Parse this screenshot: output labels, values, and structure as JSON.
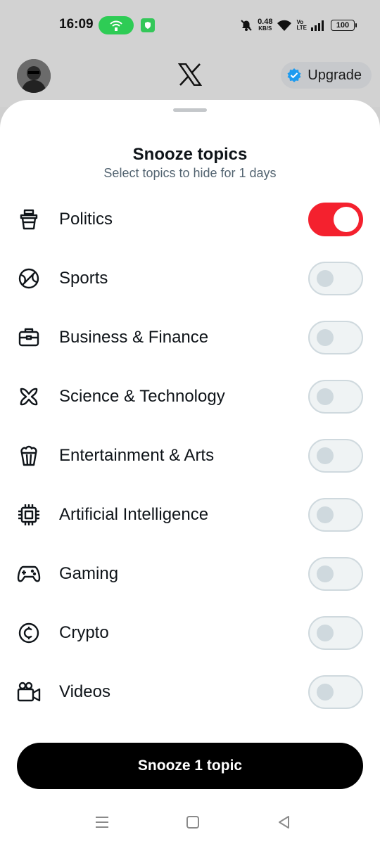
{
  "status_bar": {
    "time": "16:09",
    "net_speed_value": "0.48",
    "net_speed_unit": "KB/S",
    "volte_top": "Vo",
    "volte_bottom": "LTE",
    "battery": "100"
  },
  "header": {
    "upgrade_label": "Upgrade",
    "verified_color": "#1d9bf0"
  },
  "sheet": {
    "title": "Snooze topics",
    "subtitle": "Select topics to hide for 1 days",
    "topics": [
      {
        "label": "Politics",
        "icon": "politics-icon",
        "enabled": true
      },
      {
        "label": "Sports",
        "icon": "sports-ball-icon",
        "enabled": false
      },
      {
        "label": "Business & Finance",
        "icon": "briefcase-icon",
        "enabled": false
      },
      {
        "label": "Science & Technology",
        "icon": "atom-icon",
        "enabled": false
      },
      {
        "label": "Entertainment & Arts",
        "icon": "popcorn-icon",
        "enabled": false
      },
      {
        "label": "Artificial Intelligence",
        "icon": "chip-icon",
        "enabled": false
      },
      {
        "label": "Gaming",
        "icon": "gamepad-icon",
        "enabled": false
      },
      {
        "label": "Crypto",
        "icon": "crypto-coin-icon",
        "enabled": false
      },
      {
        "label": "Videos",
        "icon": "video-camera-icon",
        "enabled": false
      }
    ],
    "snooze_button_label": "Snooze 1 topic"
  },
  "colors": {
    "toggle_on": "#f4212e",
    "toggle_off": "#eff3f4",
    "primary_text": "#0f1419",
    "secondary_text": "#536471"
  }
}
